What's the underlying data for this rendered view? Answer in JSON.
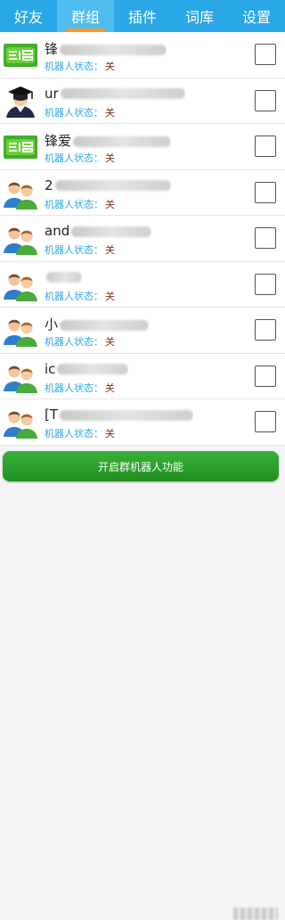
{
  "tabs": [
    {
      "label": "好友",
      "active": false
    },
    {
      "label": "群组",
      "active": true
    },
    {
      "label": "插件",
      "active": false
    },
    {
      "label": "词库",
      "active": false
    },
    {
      "label": "设置",
      "active": false
    }
  ],
  "colors": {
    "tabbar": "#2aa7e6",
    "active_indicator": "#ff9a1f",
    "status_label": "#2aa7e6",
    "status_value": "#8b2c0c",
    "button": "#2e9e2e"
  },
  "groups": [
    {
      "title": "锋",
      "status_label": "机器人状态：",
      "status_value": "关",
      "avatar": "logo-green-icon",
      "checked": false
    },
    {
      "title": "ur",
      "status_label": "机器人状态：",
      "status_value": "关",
      "avatar": "graduate-avatar-icon",
      "checked": false
    },
    {
      "title": "锋爱",
      "status_label": "机器人状态：",
      "status_value": "关",
      "avatar": "logo-green-icon",
      "checked": false
    },
    {
      "title": "2",
      "status_label": "机器人状态：",
      "status_value": "关",
      "avatar": "group-people-icon",
      "checked": false
    },
    {
      "title": "and",
      "status_label": "机器人状态：",
      "status_value": "关",
      "avatar": "group-people-icon",
      "checked": false
    },
    {
      "title": "",
      "status_label": "机器人状态：",
      "status_value": "关",
      "avatar": "group-people-icon",
      "checked": false
    },
    {
      "title": "小",
      "status_label": "机器人状态：",
      "status_value": "关",
      "avatar": "group-people-icon",
      "checked": false
    },
    {
      "title": "ic",
      "status_label": "机器人状态：",
      "status_value": "关",
      "avatar": "group-people-icon",
      "checked": false
    },
    {
      "title": "[T",
      "status_label": "机器人状态：",
      "status_value": "关",
      "avatar": "group-people-icon",
      "checked": false
    }
  ],
  "enable_button": {
    "label": "开启群机器人功能"
  }
}
